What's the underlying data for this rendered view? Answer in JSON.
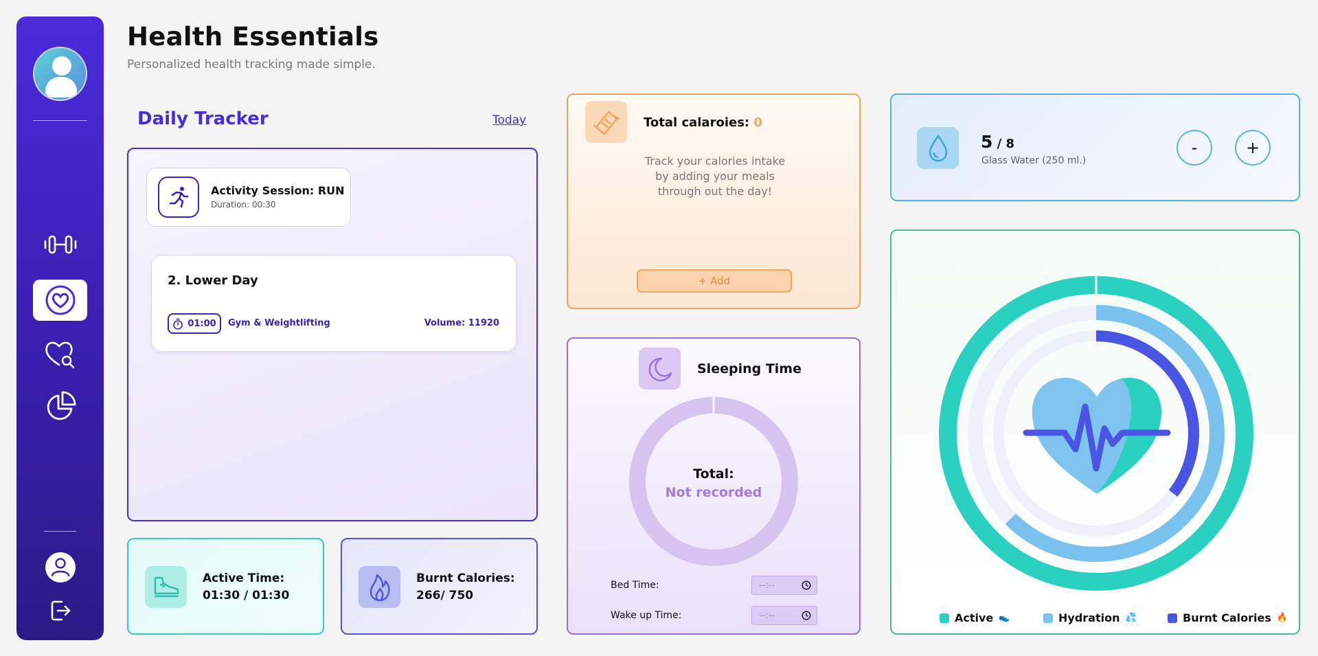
{
  "header": {
    "title": "Health Essentials",
    "subtitle": "Personalized health tracking made simple."
  },
  "sidebar": {
    "items": [
      {
        "icon": "dumbbell-icon",
        "active": false
      },
      {
        "icon": "heart-circle-icon",
        "active": true
      },
      {
        "icon": "heart-search-icon",
        "active": false
      },
      {
        "icon": "pie-chart-icon",
        "active": false
      }
    ],
    "bottom": [
      {
        "icon": "user-icon"
      },
      {
        "icon": "logout-icon"
      }
    ]
  },
  "daily_tracker": {
    "title": "Daily Tracker",
    "today_link": "Today",
    "activity": {
      "title": "Activity Session: RUN",
      "duration": "Duration: 00:30",
      "icon": "running-icon"
    },
    "workout": {
      "name": "2. Lower Day",
      "time": "01:00",
      "category": "Gym & Weightlifting",
      "volume": "Volume: 11920"
    }
  },
  "active_time": {
    "label": "Active Time:",
    "value": "01:30 / 01:30",
    "icon": "sneaker-icon"
  },
  "burnt_calories": {
    "label": "Burnt Calories:",
    "value": "266/ 750",
    "icon": "flame-icon"
  },
  "calories": {
    "title": "Total calaroies: ",
    "value": "0",
    "description": "Track your calories intake by adding your meals through out the day!",
    "add_label": "+ Add",
    "icon": "snack-bar-icon"
  },
  "sleep": {
    "title": "Sleeping Time",
    "total_label": "Total:",
    "total_value": "Not recorded",
    "bed_time_label": "Bed Time:",
    "wake_time_label": "Wake up Time:",
    "bed_time_placeholder": "--:--",
    "wake_time_placeholder": "--:--",
    "icon": "moon-icon"
  },
  "water": {
    "count": "5",
    "total": " / 8",
    "unit": "Glass Water (250 ml.)",
    "minus_label": "-",
    "plus_label": "+",
    "icon": "water-drop-icon"
  },
  "rings": {
    "center_icon": "heart-pulse-icon",
    "progress": {
      "active": 1.0,
      "hydration": 0.625,
      "burnt_calories": 0.355
    },
    "legend": [
      {
        "label": "Active",
        "color": "#2bd1c0",
        "emoji": "👟"
      },
      {
        "label": "Hydration",
        "color": "#79c2ee",
        "emoji": "💦"
      },
      {
        "label": "Burnt Calories",
        "color": "#4b55e3",
        "emoji": "🔥"
      }
    ]
  },
  "colors": {
    "accent": "#4a2ad9",
    "calories": "#f3a45c",
    "sleep": "#9a6de2",
    "water": "#5bb0e8",
    "rings_border": "#4fb88f"
  }
}
